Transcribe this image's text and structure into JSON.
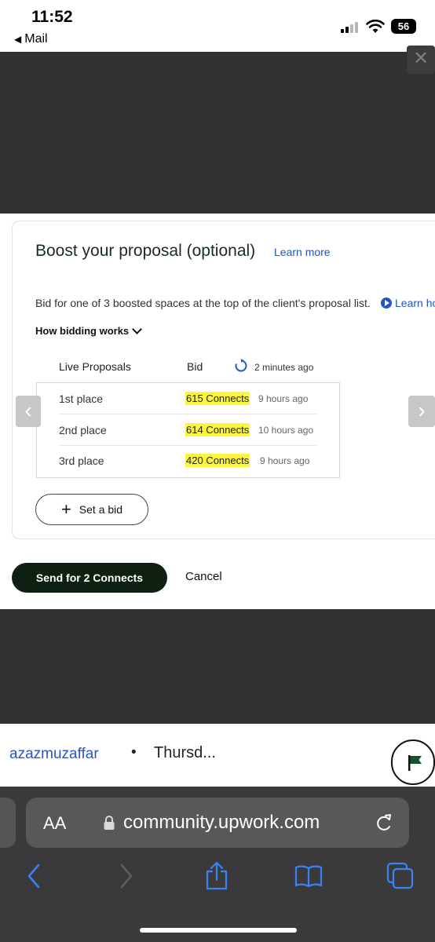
{
  "status_bar": {
    "time": "11:52",
    "back_app": "Mail",
    "battery": "56"
  },
  "close_label": "✕",
  "boost": {
    "title": "Boost your proposal (optional)",
    "learn_more": "Learn more",
    "description": "Bid for one of 3 boosted spaces at the top of the client's proposal list.",
    "learn_how": "Learn ho",
    "how_bidding": "How bidding works",
    "table": {
      "headers": {
        "live": "Live Proposals",
        "bid": "Bid",
        "updated": "2 minutes ago"
      },
      "rows": [
        {
          "place": "1st place",
          "connects": "615 Connects",
          "ago": "9 hours ago"
        },
        {
          "place": "2nd place",
          "connects": "614 Connects",
          "ago": "10 hours ago"
        },
        {
          "place": "3rd place",
          "connects": "420 Connects",
          "ago": "9 hours ago"
        }
      ]
    },
    "set_bid": "Set a bid"
  },
  "actions": {
    "send": "Send for 2 Connects",
    "cancel": "Cancel"
  },
  "post_meta": {
    "author": "azazmuzaffar",
    "separator": "•",
    "date": "Thursd..."
  },
  "safari": {
    "aa": "AA",
    "url": "community.upwork.com"
  },
  "colors": {
    "link": "#1f57c3",
    "highlight": "#fcf53b",
    "send_button": "#0e2012",
    "overlay": "#323232"
  }
}
